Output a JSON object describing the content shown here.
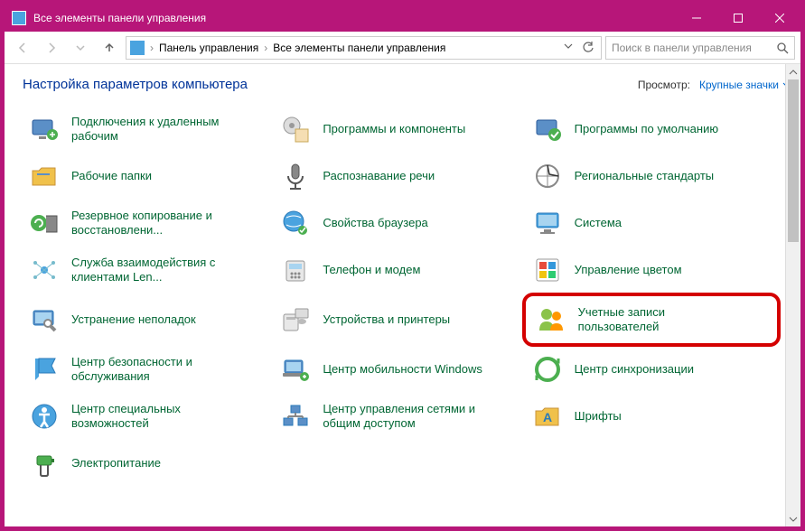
{
  "window": {
    "title": "Все элементы панели управления"
  },
  "breadcrumb": {
    "root": "Панель управления",
    "current": "Все элементы панели управления"
  },
  "search": {
    "placeholder": "Поиск в панели управления"
  },
  "heading": "Настройка параметров компьютера",
  "view": {
    "label": "Просмотр:",
    "value": "Крупные значки"
  },
  "items": [
    {
      "label": "Подключения к удаленным рабочим",
      "icon": "remote-desktop"
    },
    {
      "label": "Программы и компоненты",
      "icon": "programs"
    },
    {
      "label": "Программы по умолчанию",
      "icon": "defaults"
    },
    {
      "label": "Рабочие папки",
      "icon": "work-folders"
    },
    {
      "label": "Распознавание речи",
      "icon": "speech"
    },
    {
      "label": "Региональные стандарты",
      "icon": "region"
    },
    {
      "label": "Резервное копирование и восстановлени...",
      "icon": "backup"
    },
    {
      "label": "Свойства браузера",
      "icon": "internet"
    },
    {
      "label": "Система",
      "icon": "system"
    },
    {
      "label": "Служба взаимодействия с клиентами Len...",
      "icon": "lenovo"
    },
    {
      "label": "Телефон и модем",
      "icon": "phone"
    },
    {
      "label": "Управление цветом",
      "icon": "color"
    },
    {
      "label": "Устранение неполадок",
      "icon": "troubleshoot"
    },
    {
      "label": "Устройства и принтеры",
      "icon": "devices"
    },
    {
      "label": "Учетные записи пользователей",
      "icon": "users",
      "hl": true
    },
    {
      "label": "Центр безопасности и обслуживания",
      "icon": "security"
    },
    {
      "label": "Центр мобильности Windows",
      "icon": "mobility"
    },
    {
      "label": "Центр синхронизации",
      "icon": "sync"
    },
    {
      "label": "Центр специальных возможностей",
      "icon": "ease"
    },
    {
      "label": "Центр управления сетями и общим доступом",
      "icon": "network"
    },
    {
      "label": "Шрифты",
      "icon": "fonts"
    },
    {
      "label": "Электропитание",
      "icon": "power"
    }
  ]
}
